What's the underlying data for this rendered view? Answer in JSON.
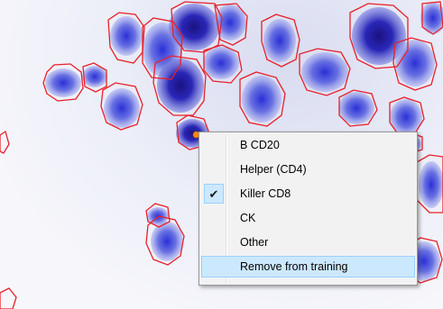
{
  "context_menu": {
    "items": [
      {
        "label": "B CD20",
        "checked": false
      },
      {
        "label": "Helper (CD4)",
        "checked": false
      },
      {
        "label": "Killer CD8",
        "checked": true
      },
      {
        "label": "CK",
        "checked": false
      },
      {
        "label": "Other",
        "checked": false
      },
      {
        "label": "Remove from training",
        "checked": false,
        "highlighted": true
      }
    ],
    "check_glyph": "✔"
  },
  "colors": {
    "cell_outline": "#e8202a",
    "cell_stain": "#3b3fd0",
    "menu_highlight": "#cce8ff",
    "marker": "#ff8a00"
  }
}
